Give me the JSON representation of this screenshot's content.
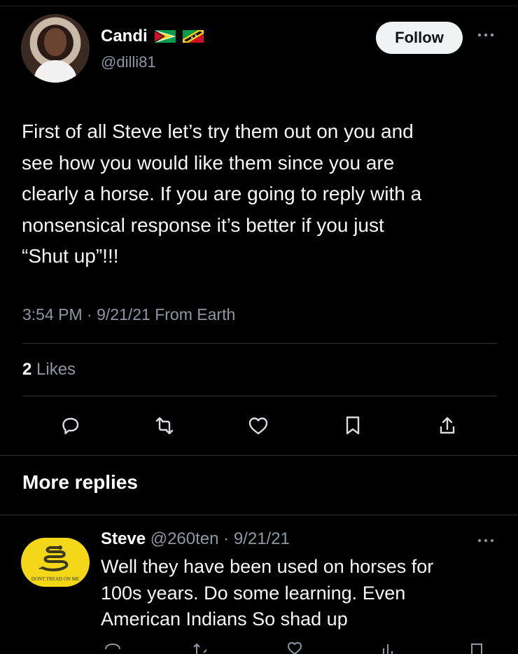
{
  "tweet": {
    "author": {
      "name": "Candi",
      "handle": "@dilli81",
      "flags": [
        "guyana-flag",
        "saint-kitts-nevis-flag"
      ]
    },
    "follow_label": "Follow",
    "text": "First of all Steve let’s try them out on you and\nsee how you would like them since you are\nclearly a horse. If you are going to reply with a\nnonsensical response it’s better if you just\n“Shut up”!!!",
    "meta": "3:54 PM · 9/21/21 From Earth",
    "likes_count": "2",
    "likes_label": " Likes",
    "actions": [
      "reply-icon",
      "retweet-icon",
      "like-icon",
      "bookmark-icon",
      "share-icon"
    ]
  },
  "more_replies": {
    "title": "More replies"
  },
  "reply": {
    "name": "Steve",
    "handle": "@260ten",
    "date": "· 9/21/21",
    "avatar_text": "DONT TREAD ON ME",
    "text": "Well they have been used on horses for\n100s years. Do some learning.  Even\nAmerican Indians   So shad up"
  },
  "colors": {
    "background": "#000000",
    "text": "#e7e9ea",
    "secondary_text": "#8b98a5",
    "divider": "#2f3336",
    "follow_button_bg": "#eff3f4",
    "avatar_yellow": "#f4d817"
  }
}
